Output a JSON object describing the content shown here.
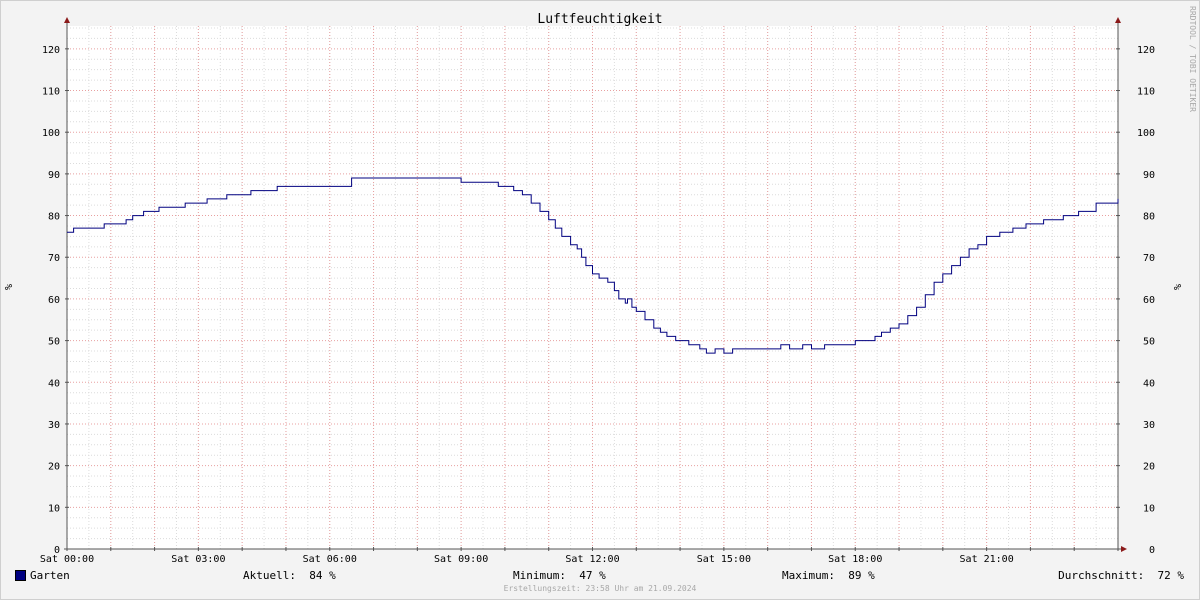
{
  "chart_data": {
    "type": "line",
    "title": "Luftfeuchtigkeit",
    "ylabel": "%",
    "ylim": [
      0,
      125
    ],
    "yticks": [
      0,
      10,
      20,
      30,
      40,
      50,
      60,
      70,
      80,
      90,
      100,
      110,
      120
    ],
    "xlim_hours": [
      0,
      24
    ],
    "xticks": [
      {
        "h": 0,
        "label": "Sat 00:00"
      },
      {
        "h": 3,
        "label": "Sat 03:00"
      },
      {
        "h": 6,
        "label": "Sat 06:00"
      },
      {
        "h": 9,
        "label": "Sat 09:00"
      },
      {
        "h": 12,
        "label": "Sat 12:00"
      },
      {
        "h": 15,
        "label": "Sat 15:00"
      },
      {
        "h": 18,
        "label": "Sat 18:00"
      },
      {
        "h": 21,
        "label": "Sat 21:00"
      }
    ],
    "grid": true,
    "series": [
      {
        "name": "Garten",
        "color": "#000080",
        "x": [
          0,
          0.15,
          0.4,
          0.85,
          1.0,
          1.35,
          1.5,
          1.75,
          2.1,
          2.7,
          3.2,
          3.65,
          4.2,
          4.8,
          5.4,
          6.5,
          6.5,
          6.5,
          6.5,
          6.5,
          6.6,
          7.0,
          8.0,
          8.6,
          9.0,
          9.5,
          9.85,
          10.0,
          10.2,
          10.4,
          10.6,
          10.8,
          11.0,
          11.15,
          11.3,
          11.5,
          11.65,
          11.75,
          11.85,
          12.0,
          12.15,
          12.35,
          12.5,
          12.6,
          12.75,
          12.8,
          12.9,
          13.0,
          13.2,
          13.4,
          13.55,
          13.7,
          13.9,
          14.2,
          14.45,
          14.6,
          14.8,
          15.0,
          15.2,
          15.35,
          15.55,
          15.85,
          16.0,
          16.3,
          16.5,
          16.8,
          17.0,
          17.3,
          17.5,
          18.0,
          18.2,
          18.45,
          18.6,
          18.8,
          19.0,
          19.2,
          19.4,
          19.6,
          19.8,
          20.0,
          20.2,
          20.4,
          20.6,
          20.8,
          21.0,
          21.3,
          21.6,
          21.9,
          22.3,
          22.75,
          23.1,
          23.5,
          24.0
        ],
        "y": [
          76,
          77,
          77,
          78,
          78,
          79,
          80,
          81,
          82,
          83,
          84,
          85,
          86,
          87,
          87,
          88,
          88,
          89,
          88,
          89,
          89,
          89,
          89,
          89,
          88,
          88,
          87,
          87,
          86,
          85,
          83,
          81,
          79,
          77,
          75,
          73,
          72,
          70,
          68,
          66,
          65,
          64,
          62,
          60,
          59,
          60,
          58,
          57,
          55,
          53,
          52,
          51,
          50,
          49,
          48,
          47,
          48,
          47,
          48,
          48,
          48,
          48,
          48,
          49,
          48,
          49,
          48,
          49,
          49,
          50,
          50,
          51,
          52,
          53,
          54,
          56,
          58,
          61,
          64,
          66,
          68,
          70,
          72,
          73,
          75,
          76,
          77,
          78,
          79,
          80,
          81,
          83,
          84
        ],
        "stats": {
          "current_label": "Aktuell:",
          "current": "84 %",
          "min_label": "Minimum:",
          "min": "47 %",
          "max_label": "Maximum:",
          "max": "89 %",
          "avg_label": "Durchschnitt:",
          "avg": "72 %"
        }
      }
    ]
  },
  "watermark": "RRDTOOL / TOBI OETIKER",
  "footer": "Erstellungszeit: 23:58 Uhr am 21.09.2024"
}
